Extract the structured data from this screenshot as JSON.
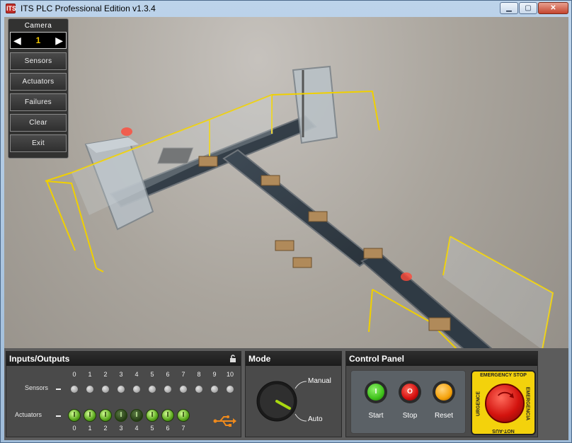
{
  "window": {
    "title": "ITS PLC Professional Edition v1.3.4",
    "app_icon": "ITS"
  },
  "camera": {
    "label": "Camera",
    "value": "1"
  },
  "menu": {
    "sensors": "Sensors",
    "actuators": "Actuators",
    "failures": "Failures",
    "clear": "Clear",
    "exit": "Exit"
  },
  "io": {
    "title": "Inputs/Outputs",
    "sensors_label": "Sensors",
    "actuators_label": "Actuators",
    "sensor_numbers": [
      "0",
      "1",
      "2",
      "3",
      "4",
      "5",
      "6",
      "7",
      "8",
      "9",
      "10"
    ],
    "actuator_numbers": [
      "0",
      "1",
      "2",
      "3",
      "4",
      "5",
      "6",
      "7"
    ],
    "actuator_states": [
      true,
      true,
      true,
      false,
      false,
      true,
      true,
      true
    ],
    "actuator_glyph": "I"
  },
  "mode": {
    "title": "Mode",
    "manual": "Manual",
    "auto": "Auto",
    "selected": "Auto"
  },
  "control": {
    "title": "Control Panel",
    "start": "Start",
    "stop": "Stop",
    "reset": "Reset",
    "start_glyph": "I",
    "stop_glyph": "O",
    "estop_top": "EMERGENCY STOP",
    "estop_bottom": "NOT-AUS",
    "estop_left": "URGENCE",
    "estop_right": "EMERGENCIA"
  },
  "colors": {
    "start": "#3fc21a",
    "stop": "#d40f0f",
    "reset": "#f5a20a",
    "estop_bg": "#f3d20c",
    "fence": "#f0d000"
  }
}
